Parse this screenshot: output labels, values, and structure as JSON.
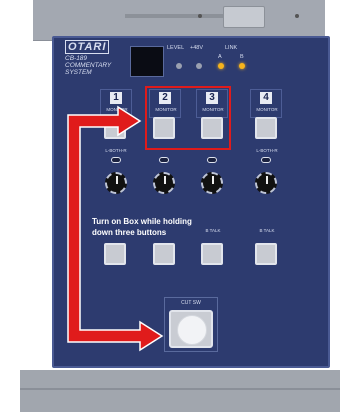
{
  "device": {
    "brand": "OTARI",
    "model_line1": "CB-189",
    "model_line2": "COMMENTARY",
    "model_line3": "SYSTEM"
  },
  "header": {
    "level_label": "LEVEL",
    "plus48_label": "+48V",
    "link_label": "LINK",
    "link_a": "A",
    "link_b": "B"
  },
  "channels": [
    {
      "number": "1",
      "label": "MONITOR"
    },
    {
      "number": "2",
      "label": "MONITOR"
    },
    {
      "number": "3",
      "label": "MONITOR"
    },
    {
      "number": "4",
      "label": "MONITOR"
    }
  ],
  "strip": {
    "lboth_left": "L-BOTH-R",
    "lboth_right": "L-BOTH-R",
    "btalk_3": "B TALK",
    "btalk_4": "B TALK"
  },
  "cut_sw": {
    "label": "CUT SW"
  },
  "annotation": {
    "line1": "Turn on Box while holding",
    "line2": "down three buttons"
  },
  "colors": {
    "panel": "#2d3b6f",
    "arrow": "#e01b1b",
    "led_on": "#f6b41c"
  }
}
